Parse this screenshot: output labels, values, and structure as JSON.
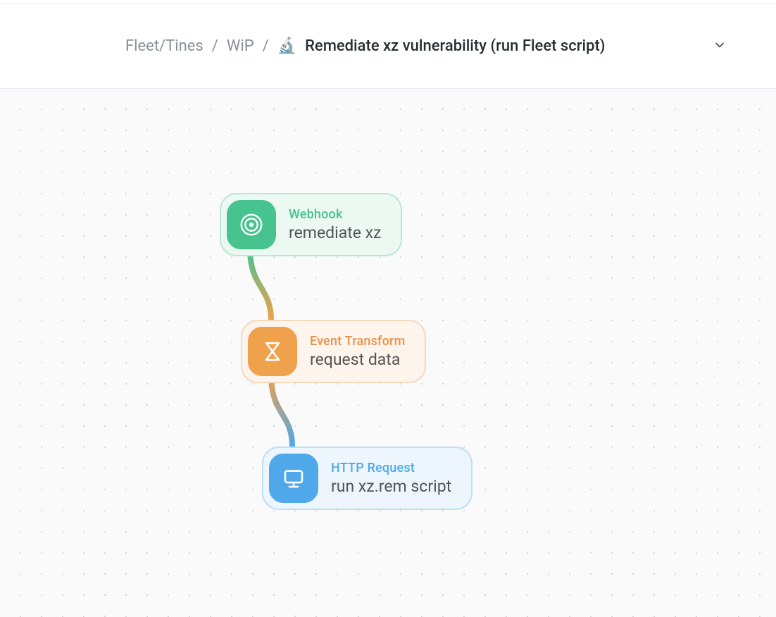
{
  "breadcrumb": {
    "crumb1": "Fleet/Tines",
    "sep": "/",
    "crumb2": "WiP",
    "emoji": "🔬",
    "title": "Remediate xz vulnerability (run Fleet script)"
  },
  "nodes": {
    "webhook": {
      "type": "Webhook",
      "name": "remediate xz"
    },
    "transform": {
      "type": "Event Transform",
      "name": "request data"
    },
    "http": {
      "type": "HTTP Request",
      "name": "run xz.rem script"
    }
  },
  "colors": {
    "webhook": "#46c38f",
    "transform": "#f0a14b",
    "http": "#4ea8ea"
  }
}
